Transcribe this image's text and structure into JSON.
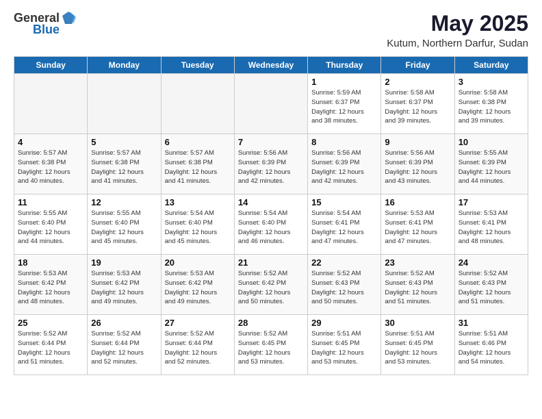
{
  "header": {
    "logo_general": "General",
    "logo_blue": "Blue",
    "title": "May 2025",
    "location": "Kutum, Northern Darfur, Sudan"
  },
  "weekdays": [
    "Sunday",
    "Monday",
    "Tuesday",
    "Wednesday",
    "Thursday",
    "Friday",
    "Saturday"
  ],
  "weeks": [
    [
      {
        "day": "",
        "info": ""
      },
      {
        "day": "",
        "info": ""
      },
      {
        "day": "",
        "info": ""
      },
      {
        "day": "",
        "info": ""
      },
      {
        "day": "1",
        "info": "Sunrise: 5:59 AM\nSunset: 6:37 PM\nDaylight: 12 hours\nand 38 minutes."
      },
      {
        "day": "2",
        "info": "Sunrise: 5:58 AM\nSunset: 6:37 PM\nDaylight: 12 hours\nand 39 minutes."
      },
      {
        "day": "3",
        "info": "Sunrise: 5:58 AM\nSunset: 6:38 PM\nDaylight: 12 hours\nand 39 minutes."
      }
    ],
    [
      {
        "day": "4",
        "info": "Sunrise: 5:57 AM\nSunset: 6:38 PM\nDaylight: 12 hours\nand 40 minutes."
      },
      {
        "day": "5",
        "info": "Sunrise: 5:57 AM\nSunset: 6:38 PM\nDaylight: 12 hours\nand 41 minutes."
      },
      {
        "day": "6",
        "info": "Sunrise: 5:57 AM\nSunset: 6:38 PM\nDaylight: 12 hours\nand 41 minutes."
      },
      {
        "day": "7",
        "info": "Sunrise: 5:56 AM\nSunset: 6:39 PM\nDaylight: 12 hours\nand 42 minutes."
      },
      {
        "day": "8",
        "info": "Sunrise: 5:56 AM\nSunset: 6:39 PM\nDaylight: 12 hours\nand 42 minutes."
      },
      {
        "day": "9",
        "info": "Sunrise: 5:56 AM\nSunset: 6:39 PM\nDaylight: 12 hours\nand 43 minutes."
      },
      {
        "day": "10",
        "info": "Sunrise: 5:55 AM\nSunset: 6:39 PM\nDaylight: 12 hours\nand 44 minutes."
      }
    ],
    [
      {
        "day": "11",
        "info": "Sunrise: 5:55 AM\nSunset: 6:40 PM\nDaylight: 12 hours\nand 44 minutes."
      },
      {
        "day": "12",
        "info": "Sunrise: 5:55 AM\nSunset: 6:40 PM\nDaylight: 12 hours\nand 45 minutes."
      },
      {
        "day": "13",
        "info": "Sunrise: 5:54 AM\nSunset: 6:40 PM\nDaylight: 12 hours\nand 45 minutes."
      },
      {
        "day": "14",
        "info": "Sunrise: 5:54 AM\nSunset: 6:40 PM\nDaylight: 12 hours\nand 46 minutes."
      },
      {
        "day": "15",
        "info": "Sunrise: 5:54 AM\nSunset: 6:41 PM\nDaylight: 12 hours\nand 47 minutes."
      },
      {
        "day": "16",
        "info": "Sunrise: 5:53 AM\nSunset: 6:41 PM\nDaylight: 12 hours\nand 47 minutes."
      },
      {
        "day": "17",
        "info": "Sunrise: 5:53 AM\nSunset: 6:41 PM\nDaylight: 12 hours\nand 48 minutes."
      }
    ],
    [
      {
        "day": "18",
        "info": "Sunrise: 5:53 AM\nSunset: 6:42 PM\nDaylight: 12 hours\nand 48 minutes."
      },
      {
        "day": "19",
        "info": "Sunrise: 5:53 AM\nSunset: 6:42 PM\nDaylight: 12 hours\nand 49 minutes."
      },
      {
        "day": "20",
        "info": "Sunrise: 5:53 AM\nSunset: 6:42 PM\nDaylight: 12 hours\nand 49 minutes."
      },
      {
        "day": "21",
        "info": "Sunrise: 5:52 AM\nSunset: 6:42 PM\nDaylight: 12 hours\nand 50 minutes."
      },
      {
        "day": "22",
        "info": "Sunrise: 5:52 AM\nSunset: 6:43 PM\nDaylight: 12 hours\nand 50 minutes."
      },
      {
        "day": "23",
        "info": "Sunrise: 5:52 AM\nSunset: 6:43 PM\nDaylight: 12 hours\nand 51 minutes."
      },
      {
        "day": "24",
        "info": "Sunrise: 5:52 AM\nSunset: 6:43 PM\nDaylight: 12 hours\nand 51 minutes."
      }
    ],
    [
      {
        "day": "25",
        "info": "Sunrise: 5:52 AM\nSunset: 6:44 PM\nDaylight: 12 hours\nand 51 minutes."
      },
      {
        "day": "26",
        "info": "Sunrise: 5:52 AM\nSunset: 6:44 PM\nDaylight: 12 hours\nand 52 minutes."
      },
      {
        "day": "27",
        "info": "Sunrise: 5:52 AM\nSunset: 6:44 PM\nDaylight: 12 hours\nand 52 minutes."
      },
      {
        "day": "28",
        "info": "Sunrise: 5:52 AM\nSunset: 6:45 PM\nDaylight: 12 hours\nand 53 minutes."
      },
      {
        "day": "29",
        "info": "Sunrise: 5:51 AM\nSunset: 6:45 PM\nDaylight: 12 hours\nand 53 minutes."
      },
      {
        "day": "30",
        "info": "Sunrise: 5:51 AM\nSunset: 6:45 PM\nDaylight: 12 hours\nand 53 minutes."
      },
      {
        "day": "31",
        "info": "Sunrise: 5:51 AM\nSunset: 6:46 PM\nDaylight: 12 hours\nand 54 minutes."
      }
    ]
  ]
}
